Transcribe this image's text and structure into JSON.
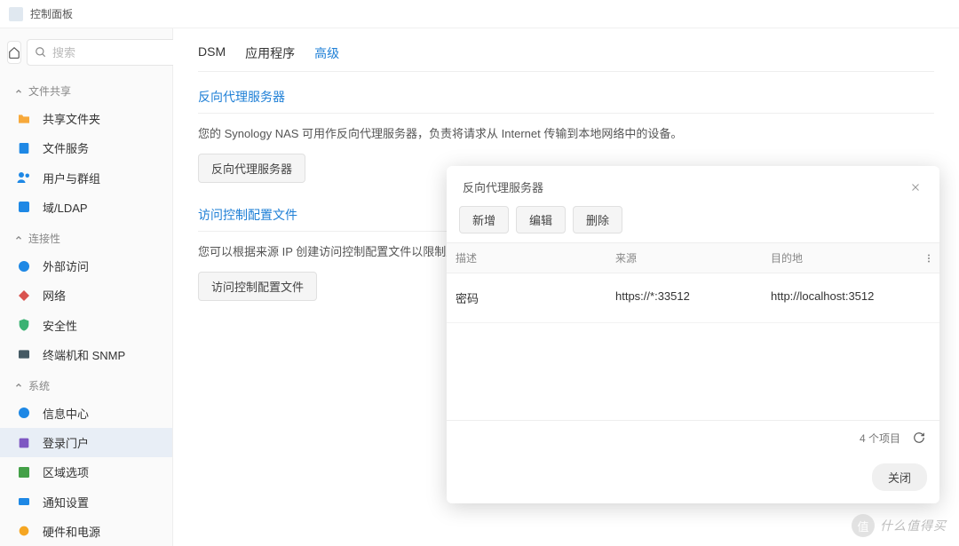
{
  "window": {
    "title": "控制面板"
  },
  "search": {
    "placeholder": "搜索"
  },
  "sidebar": {
    "groups": [
      {
        "label": "文件共享",
        "items": [
          {
            "label": "共享文件夹",
            "icon": "folder",
            "color": "#f7a93b"
          },
          {
            "label": "文件服务",
            "icon": "file-service",
            "color": "#1e88e5"
          },
          {
            "label": "用户与群组",
            "icon": "users",
            "color": "#1e88e5"
          },
          {
            "label": "域/LDAP",
            "icon": "ldap",
            "color": "#1e88e5"
          }
        ]
      },
      {
        "label": "连接性",
        "items": [
          {
            "label": "外部访问",
            "icon": "external",
            "color": "#1e88e5"
          },
          {
            "label": "网络",
            "icon": "network",
            "color": "#d9534f"
          },
          {
            "label": "安全性",
            "icon": "security",
            "color": "#3bb273"
          },
          {
            "label": "终端机和 SNMP",
            "icon": "terminal",
            "color": "#455a64"
          }
        ]
      },
      {
        "label": "系统",
        "items": [
          {
            "label": "信息中心",
            "icon": "info",
            "color": "#1e88e5"
          },
          {
            "label": "登录门户",
            "icon": "portal",
            "color": "#7e57c2",
            "active": true
          },
          {
            "label": "区域选项",
            "icon": "regional",
            "color": "#43a047"
          },
          {
            "label": "通知设置",
            "icon": "notify",
            "color": "#1e88e5"
          },
          {
            "label": "硬件和电源",
            "icon": "hardware",
            "color": "#f5a623"
          }
        ]
      }
    ]
  },
  "tabs": [
    {
      "label": "DSM"
    },
    {
      "label": "应用程序"
    },
    {
      "label": "高级",
      "active": true
    }
  ],
  "sections": {
    "reverse_proxy": {
      "title": "反向代理服务器",
      "desc": "您的 Synology NAS 可用作反向代理服务器，负责将请求从 Internet 传输到本地网络中的设备。",
      "button": "反向代理服务器"
    },
    "access_control": {
      "title": "访问控制配置文件",
      "desc": "您可以根据来源 IP 创建访问控制配置文件以限制用户访问",
      "button": "访问控制配置文件"
    }
  },
  "modal": {
    "title": "反向代理服务器",
    "toolbar": {
      "create": "新增",
      "edit": "编辑",
      "delete": "删除"
    },
    "columns": {
      "desc": "描述",
      "source": "来源",
      "dest": "目的地"
    },
    "rows": [
      {
        "desc": "密码",
        "source": "https://*:33512",
        "dest": "http://localhost:3512"
      }
    ],
    "footer": {
      "count": "4 个项目"
    },
    "close": "关闭"
  },
  "watermark": {
    "badge": "值",
    "text": "什么值得买"
  }
}
